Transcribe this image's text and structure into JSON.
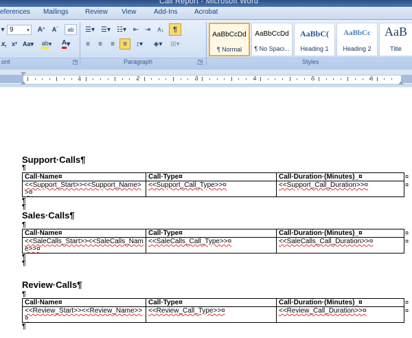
{
  "window": {
    "title": "Call Report - Microsoft Word"
  },
  "tabs": [
    "eferences",
    "Mailings",
    "Review",
    "View",
    "Add-Ins",
    "Acrobat"
  ],
  "ribbon": {
    "font_size": "9",
    "group_labels": {
      "font": "ont",
      "paragraph": "Paragraph",
      "styles": "Styles"
    },
    "styles": [
      {
        "preview": "AaBbCcDd",
        "name": "¶ Normal"
      },
      {
        "preview": "AaBbCcDd",
        "name": "¶ No Spaci..."
      },
      {
        "preview": "AaBbC(",
        "name": "Heading 1"
      },
      {
        "preview": "AaBbCc",
        "name": "Heading 2"
      },
      {
        "preview": "AaB",
        "name": "Title"
      }
    ],
    "pilcrow": "¶"
  },
  "ruler": {
    "numbers": [
      "1",
      "2",
      "3",
      "4",
      "5",
      "6"
    ]
  },
  "document": {
    "mark": "¶",
    "cell_end": "¤",
    "sections": [
      {
        "heading": "Support·Calls¶",
        "columns": [
          "Call·Name¤",
          "Call·Type¤",
          "Call·Duration·(Minutes)_¤"
        ],
        "row": [
          "<<Support_Start>><<Support_Name>>¤",
          "<<Support_Call_Type>>¤",
          "<<Support_Call_Duration>>¤"
        ]
      },
      {
        "heading": "Sales·Calls¶",
        "columns": [
          "Call·Name¤",
          "Call·Type¤",
          "Call·Duration·(Minutes)_¤"
        ],
        "row": [
          "<<SaleCalls_Start>><<SaleCalls_Name>>¤",
          "<<SaleCalls_Call_Type>>¤",
          "<<SaleCalls_Call_Duration>>¤"
        ]
      },
      {
        "heading": "Review·Calls¶",
        "columns": [
          "Call·Name¤",
          "Call·Type¤",
          "Call·Duration·(Minutes)_¤"
        ],
        "row": [
          "<<Review_Start>><<Review_Name>>¤",
          "<<Review_Call_Type>>¤",
          "<<Review_Call_Duration>>¤"
        ]
      }
    ]
  }
}
